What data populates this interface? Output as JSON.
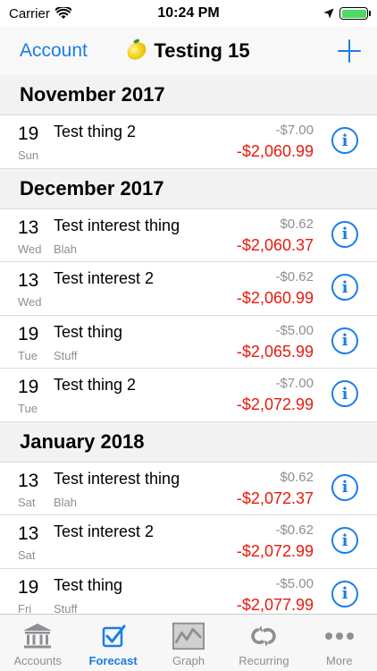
{
  "status_bar": {
    "carrier": "Carrier",
    "time": "10:24 PM"
  },
  "nav": {
    "back_label": "Account",
    "title": "Testing 15"
  },
  "sections": [
    {
      "title": "November 2017",
      "rows": [
        {
          "day": "19",
          "weekday": "Sun",
          "description": "Test thing 2",
          "note": "",
          "amount": "-$7.00",
          "balance": "-$2,060.99"
        }
      ]
    },
    {
      "title": "December 2017",
      "rows": [
        {
          "day": "13",
          "weekday": "Wed",
          "description": "Test interest thing",
          "note": "Blah",
          "amount": "$0.62",
          "balance": "-$2,060.37"
        },
        {
          "day": "13",
          "weekday": "Wed",
          "description": "Test interest 2",
          "note": "",
          "amount": "-$0.62",
          "balance": "-$2,060.99"
        },
        {
          "day": "19",
          "weekday": "Tue",
          "description": "Test thing",
          "note": "Stuff",
          "amount": "-$5.00",
          "balance": "-$2,065.99"
        },
        {
          "day": "19",
          "weekday": "Tue",
          "description": "Test thing 2",
          "note": "",
          "amount": "-$7.00",
          "balance": "-$2,072.99"
        }
      ]
    },
    {
      "title": "January 2018",
      "rows": [
        {
          "day": "13",
          "weekday": "Sat",
          "description": "Test interest thing",
          "note": "Blah",
          "amount": "$0.62",
          "balance": "-$2,072.37"
        },
        {
          "day": "13",
          "weekday": "Sat",
          "description": "Test interest 2",
          "note": "",
          "amount": "-$0.62",
          "balance": "-$2,072.99"
        },
        {
          "day": "19",
          "weekday": "Fri",
          "description": "Test thing",
          "note": "Stuff",
          "amount": "-$5.00",
          "balance": "-$2,077.99"
        }
      ]
    }
  ],
  "tabs": [
    {
      "label": "Accounts",
      "icon": "bank-icon",
      "active": false
    },
    {
      "label": "Forecast",
      "icon": "checkbox-icon",
      "active": true
    },
    {
      "label": "Graph",
      "icon": "graph-icon",
      "active": false
    },
    {
      "label": "Recurring",
      "icon": "recurring-icon",
      "active": false
    },
    {
      "label": "More",
      "icon": "more-icon",
      "active": false
    }
  ],
  "colors": {
    "accent": "#1a7de8",
    "negative_balance": "#e8190e",
    "secondary_text": "#8e8e93",
    "battery": "#4cd964"
  }
}
